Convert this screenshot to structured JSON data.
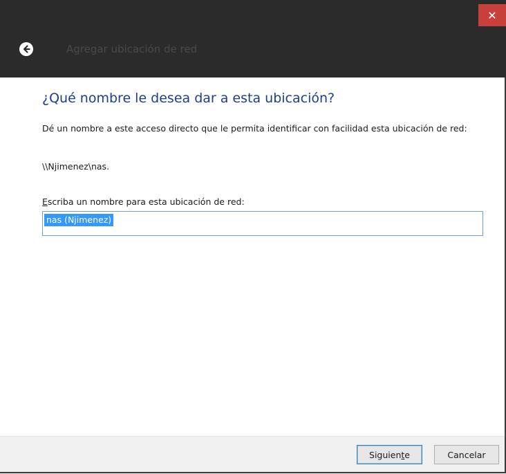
{
  "window": {
    "close_glyph": "✕",
    "nav_title": "Agregar ubicación de red"
  },
  "content": {
    "heading": "¿Qué nombre le desea dar a esta ubicación?",
    "description": "Dé un nombre a este acceso directo que le permita identificar con facilidad esta ubicación de red:",
    "network_path": "\\\\Njimenez\\nas.",
    "field_label_accel": "E",
    "field_label_rest": "scriba un nombre para esta ubicación de red:",
    "name_value": "nas (Njimenez)"
  },
  "footer": {
    "next_label_pre": "Siguien",
    "next_label_accel": "t",
    "next_label_post": "e",
    "cancel_label": "Cancelar"
  },
  "icons": {
    "back": "back-arrow-circle-icon",
    "close": "close-icon"
  },
  "colors": {
    "titlebar": "#2b2b2b",
    "close_button": "#c7403a",
    "heading": "#1e3d8f",
    "selection": "#3399ff",
    "input_border": "#6aa0d8",
    "footer": "#f0f0f0"
  }
}
